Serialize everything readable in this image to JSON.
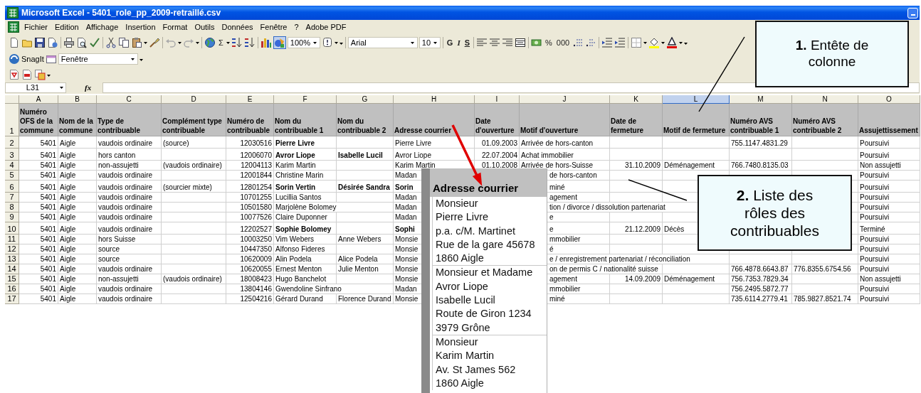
{
  "window": {
    "title": "Microsoft Excel - 5401_role_pp_2009-retraillé.csv"
  },
  "menu": [
    "Fichier",
    "Edition",
    "Affichage",
    "Insertion",
    "Format",
    "Outils",
    "Données",
    "Fenêtre",
    "?",
    "Adobe PDF"
  ],
  "toolbar": {
    "autosum": "Σ",
    "zoom": "100%",
    "font": "Arial",
    "font_size": "10",
    "bold": "G",
    "italic": "I",
    "underline": "S",
    "percent": "%",
    "thousands": "000"
  },
  "snagit_toolbar": {
    "label": "SnagIt",
    "profile": "Fenêtre"
  },
  "formula_bar": {
    "cell": "L31",
    "function": "fx"
  },
  "sheet": {
    "header_row": "1",
    "columns": [
      {
        "letter": "A",
        "selected": false,
        "kind": "number",
        "heading": "Numéro OFS de la commune"
      },
      {
        "letter": "B",
        "selected": false,
        "kind": "text",
        "heading": "Nom de la commune"
      },
      {
        "letter": "C",
        "selected": false,
        "kind": "text",
        "heading": "Type de contribuable"
      },
      {
        "letter": "D",
        "selected": false,
        "kind": "text",
        "heading": "Complément type contribuable"
      },
      {
        "letter": "E",
        "selected": false,
        "kind": "number",
        "heading": "Numéro de contribuable"
      },
      {
        "letter": "F",
        "selected": false,
        "kind": "text",
        "heading": "Nom du contribuable 1"
      },
      {
        "letter": "G",
        "selected": false,
        "kind": "text",
        "heading": "Nom du contribuable 2"
      },
      {
        "letter": "H",
        "selected": false,
        "kind": "text",
        "heading": "Adresse courrier"
      },
      {
        "letter": "I",
        "selected": false,
        "kind": "number",
        "heading": "Date d'ouverture"
      },
      {
        "letter": "J",
        "selected": false,
        "kind": "text",
        "heading": "Motif d'ouverture"
      },
      {
        "letter": "K",
        "selected": false,
        "kind": "number",
        "heading": "Date de fermeture"
      },
      {
        "letter": "L",
        "selected": true,
        "kind": "text",
        "heading": "Motif de fermeture"
      },
      {
        "letter": "M",
        "selected": false,
        "kind": "text",
        "heading": "Numéro AVS contribuable 1"
      },
      {
        "letter": "N",
        "selected": false,
        "kind": "text",
        "heading": "Numéro AVS contribuable 2"
      },
      {
        "letter": "O",
        "selected": false,
        "kind": "text",
        "heading": "Assujettissement"
      }
    ],
    "rows": [
      {
        "number": "2",
        "cells": [
          {
            "text": "5401",
            "bold": false
          },
          {
            "text": "Aigle",
            "bold": false
          },
          {
            "text": "vaudois ordinaire",
            "bold": false
          },
          {
            "text": "(source)",
            "bold": false
          },
          {
            "text": "12030516",
            "bold": false
          },
          {
            "text": "Pierre Livre",
            "bold": true
          },
          null,
          {
            "text": "Pierre Livre",
            "bold": false
          },
          {
            "text": "01.09.2003",
            "bold": false
          },
          {
            "text": "Arrivée de hors-canton",
            "bold": false
          },
          null,
          null,
          {
            "text": "755.1147.4831.29",
            "bold": false
          },
          null,
          {
            "text": "Poursuivi",
            "bold": false
          }
        ]
      },
      {
        "number": "3",
        "cells": [
          {
            "text": "5401",
            "bold": false
          },
          {
            "text": "Aigle",
            "bold": false
          },
          {
            "text": "hors canton",
            "bold": false
          },
          null,
          {
            "text": "12006070",
            "bold": false
          },
          {
            "text": "Avror Liope",
            "bold": true
          },
          {
            "text": "Isabelle Lucil",
            "bold": true
          },
          {
            "text": "Avror Liope",
            "bold": false
          },
          {
            "text": "22.07.2004",
            "bold": false
          },
          {
            "text": "Achat immobilier",
            "bold": false
          },
          null,
          null,
          null,
          null,
          {
            "text": "Poursuivi",
            "bold": false
          }
        ]
      },
      {
        "number": "4",
        "cells": [
          {
            "text": "5401",
            "bold": false
          },
          {
            "text": "Aigle",
            "bold": false
          },
          {
            "text": "non-assujetti",
            "bold": false
          },
          {
            "text": "(vaudois ordinaire)",
            "bold": false
          },
          {
            "text": "12004113",
            "bold": false
          },
          {
            "text": "Karim Martin",
            "bold": false
          },
          null,
          {
            "text": "Karim Martin",
            "bold": false
          },
          {
            "text": "01.10.2008",
            "bold": false
          },
          {
            "text": "Arrivée de hors-Suisse",
            "bold": false
          },
          {
            "text": "31.10.2009",
            "bold": false
          },
          {
            "text": "Déménagement",
            "bold": false
          },
          {
            "text": "766.7480.8135.03",
            "bold": false
          },
          null,
          {
            "text": "Non assujetti",
            "bold": false
          }
        ]
      },
      {
        "number": "5",
        "cells": [
          {
            "text": "5401",
            "bold": false
          },
          {
            "text": "Aigle",
            "bold": false
          },
          {
            "text": "vaudois ordinaire",
            "bold": false
          },
          null,
          {
            "text": "12001844",
            "bold": false
          },
          {
            "text": "Christine Marin",
            "bold": false
          },
          null,
          {
            "text": "Madan",
            "bold": false
          },
          null,
          {
            "text": "de hors-canton",
            "bold": false
          },
          null,
          null,
          null,
          null,
          {
            "text": "Poursuivi",
            "bold": false
          }
        ]
      },
      {
        "number": "6",
        "cells": [
          {
            "text": "5401",
            "bold": false
          },
          {
            "text": "Aigle",
            "bold": false
          },
          {
            "text": "vaudois ordinaire",
            "bold": false
          },
          {
            "text": "(sourcier mixte)",
            "bold": false
          },
          {
            "text": "12801254",
            "bold": false
          },
          {
            "text": "Sorin Vertin",
            "bold": true
          },
          {
            "text": "Désirée Sandra",
            "bold": true
          },
          {
            "text": "Sorin",
            "bold": true
          },
          null,
          {
            "text": "miné",
            "bold": false
          },
          null,
          null,
          null,
          null,
          {
            "text": "Poursuivi",
            "bold": false
          }
        ]
      },
      {
        "number": "7",
        "cells": [
          {
            "text": "5401",
            "bold": false
          },
          {
            "text": "Aigle",
            "bold": false
          },
          {
            "text": "vaudois ordinaire",
            "bold": false
          },
          null,
          {
            "text": "10701255",
            "bold": false
          },
          {
            "text": "Lucillia Santos",
            "bold": false
          },
          null,
          {
            "text": "Madan",
            "bold": false
          },
          null,
          {
            "text": "agement",
            "bold": false
          },
          null,
          null,
          null,
          null,
          {
            "text": "Poursuivi",
            "bold": false
          }
        ]
      },
      {
        "number": "8",
        "cells": [
          {
            "text": "5401",
            "bold": false
          },
          {
            "text": "Aigle",
            "bold": false
          },
          {
            "text": "vaudois ordinaire",
            "bold": false
          },
          null,
          {
            "text": "10501580",
            "bold": false
          },
          {
            "text": "Marjolène Bolomey",
            "bold": false
          },
          null,
          {
            "text": "Madan",
            "bold": false
          },
          null,
          {
            "text": "tion / divorce / dissolution partenariat",
            "bold": false
          },
          null,
          null,
          null,
          null,
          {
            "text": "Poursuivi",
            "bold": false
          }
        ]
      },
      {
        "number": "9",
        "cells": [
          {
            "text": "5401",
            "bold": false
          },
          {
            "text": "Aigle",
            "bold": false
          },
          {
            "text": "vaudois ordinaire",
            "bold": false
          },
          null,
          {
            "text": "10077526",
            "bold": false
          },
          {
            "text": "Claire Duponner",
            "bold": false
          },
          null,
          {
            "text": "Madan",
            "bold": false
          },
          null,
          {
            "text": "e",
            "bold": false
          },
          null,
          null,
          null,
          null,
          {
            "text": "Poursuivi",
            "bold": false
          }
        ]
      },
      {
        "number": "10",
        "cells": [
          {
            "text": "5401",
            "bold": false
          },
          {
            "text": "Aigle",
            "bold": false
          },
          {
            "text": "vaudois ordinaire",
            "bold": false
          },
          null,
          {
            "text": "12202527",
            "bold": false
          },
          {
            "text": "Sophie Bolomey",
            "bold": true
          },
          null,
          {
            "text": "Sophi",
            "bold": true
          },
          null,
          {
            "text": "e",
            "bold": false
          },
          {
            "text": "21.12.2009",
            "bold": false
          },
          {
            "text": "Décès",
            "bold": false
          },
          null,
          null,
          {
            "text": "Terminé",
            "bold": false
          }
        ]
      },
      {
        "number": "11",
        "cells": [
          {
            "text": "5401",
            "bold": false
          },
          {
            "text": "Aigle",
            "bold": false
          },
          {
            "text": "hors Suisse",
            "bold": false
          },
          null,
          {
            "text": "10003250",
            "bold": false
          },
          {
            "text": "Vim Webers",
            "bold": false
          },
          {
            "text": "Anne Webers",
            "bold": false
          },
          {
            "text": "Monsie",
            "bold": false
          },
          null,
          {
            "text": "mmobilier",
            "bold": false
          },
          null,
          null,
          null,
          null,
          {
            "text": "Poursuivi",
            "bold": false
          }
        ]
      },
      {
        "number": "12",
        "cells": [
          {
            "text": "5401",
            "bold": false
          },
          {
            "text": "Aigle",
            "bold": false
          },
          {
            "text": "source",
            "bold": false
          },
          null,
          {
            "text": "10447350",
            "bold": false
          },
          {
            "text": "Alfonso Fideres",
            "bold": false
          },
          null,
          {
            "text": "Monsie",
            "bold": false
          },
          null,
          {
            "text": "é",
            "bold": false
          },
          null,
          null,
          null,
          null,
          {
            "text": "Poursuivi",
            "bold": false
          }
        ]
      },
      {
        "number": "13",
        "cells": [
          {
            "text": "5401",
            "bold": false
          },
          {
            "text": "Aigle",
            "bold": false
          },
          {
            "text": "source",
            "bold": false
          },
          null,
          {
            "text": "10620009",
            "bold": false
          },
          {
            "text": "Alin Podela",
            "bold": false
          },
          {
            "text": "Alice Podela",
            "bold": false
          },
          {
            "text": "Monsie",
            "bold": false
          },
          null,
          {
            "text": "e / enregistrement partenariat / réconciliation",
            "bold": false
          },
          null,
          null,
          null,
          null,
          {
            "text": "Poursuivi",
            "bold": false
          }
        ]
      },
      {
        "number": "14",
        "cells": [
          {
            "text": "5401",
            "bold": false
          },
          {
            "text": "Aigle",
            "bold": false
          },
          {
            "text": "vaudois ordinaire",
            "bold": false
          },
          null,
          {
            "text": "10620055",
            "bold": false
          },
          {
            "text": "Ernest Menton",
            "bold": false
          },
          {
            "text": "Julie Menton",
            "bold": false
          },
          {
            "text": "Monsie",
            "bold": false
          },
          null,
          {
            "text": "on de permis C / nationalité suisse",
            "bold": false
          },
          null,
          null,
          {
            "text": "766.4878.6643.87",
            "bold": false
          },
          {
            "text": "776.8355.6754.56",
            "bold": false
          },
          {
            "text": "Poursuivi",
            "bold": false
          }
        ]
      },
      {
        "number": "15",
        "cells": [
          {
            "text": "5401",
            "bold": false
          },
          {
            "text": "Aigle",
            "bold": false
          },
          {
            "text": "non-assujetti",
            "bold": false
          },
          {
            "text": "(vaudois ordinaire)",
            "bold": false
          },
          {
            "text": "18008423",
            "bold": false
          },
          {
            "text": "Hugo Banchelot",
            "bold": false
          },
          null,
          {
            "text": "Monsie",
            "bold": false
          },
          null,
          {
            "text": "agement",
            "bold": false
          },
          {
            "text": "14.09.2009",
            "bold": false
          },
          {
            "text": "Déménagement",
            "bold": false
          },
          {
            "text": "756.7353.7829.34",
            "bold": false
          },
          null,
          {
            "text": "Non assujetti",
            "bold": false
          }
        ]
      },
      {
        "number": "16",
        "cells": [
          {
            "text": "5401",
            "bold": false
          },
          {
            "text": "Aigle",
            "bold": false
          },
          {
            "text": "vaudois ordinaire",
            "bold": false
          },
          null,
          {
            "text": "13804146",
            "bold": false
          },
          {
            "text": "Gwendoline Sinfrano",
            "bold": false
          },
          null,
          {
            "text": "Madan",
            "bold": false
          },
          null,
          {
            "text": "mmobilier",
            "bold": false
          },
          null,
          null,
          {
            "text": "756.2495.5872.77",
            "bold": false
          },
          null,
          {
            "text": "Poursuivi",
            "bold": false
          }
        ]
      },
      {
        "number": "17",
        "cells": [
          {
            "text": "5401",
            "bold": false
          },
          {
            "text": "Aigle",
            "bold": false
          },
          {
            "text": "vaudois ordinaire",
            "bold": false
          },
          null,
          {
            "text": "12504216",
            "bold": false
          },
          {
            "text": "Gérard Durand",
            "bold": false
          },
          {
            "text": "Florence Durand",
            "bold": false
          },
          {
            "text": "Monsie",
            "bold": false
          },
          null,
          {
            "text": "miné",
            "bold": false
          },
          null,
          null,
          {
            "text": "735.6114.2779.41",
            "bold": false
          },
          {
            "text": "785.9827.8521.74",
            "bold": false
          },
          {
            "text": "Poursuivi",
            "bold": false
          }
        ]
      }
    ]
  },
  "magnifier": {
    "heading": "Adresse courrier",
    "addresses": [
      {
        "lines": [
          "Monsieur",
          "Pierre Livre",
          "p.a. c/M. Martinet",
          "Rue de la gare 45678",
          "1860 Aigle"
        ]
      },
      {
        "lines": [
          "Monsieur et Madame",
          "Avror Liope",
          "Isabelle Lucil",
          "Route de Giron 1234",
          "3979 Grône"
        ]
      },
      {
        "lines": [
          "Monsieur",
          "Karim Martin",
          "Av. St James 562",
          "1860 Aigle"
        ]
      }
    ]
  },
  "callouts": [
    {
      "text": "**1.** Entête de colonne"
    },
    {
      "text": "**2.** Liste des rôles des contribuables"
    }
  ]
}
